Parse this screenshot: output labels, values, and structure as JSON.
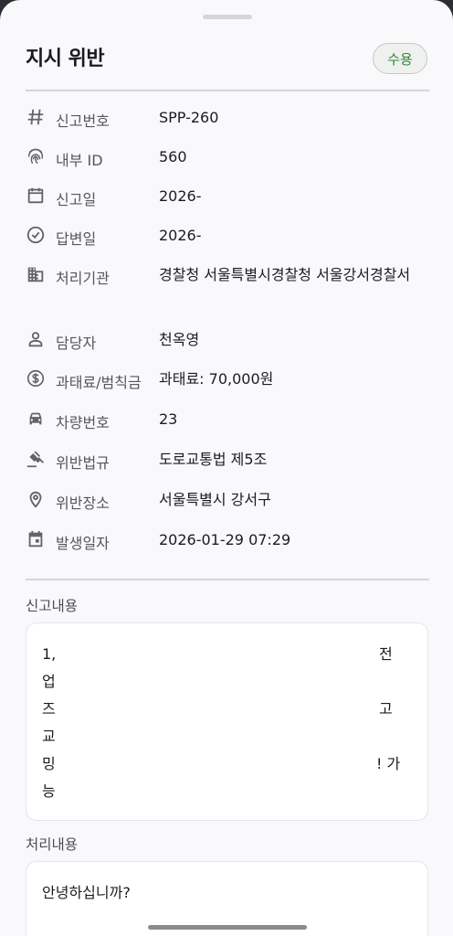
{
  "header": {
    "title": "지시 위반",
    "status": "수용"
  },
  "details": [
    {
      "icon": "hash-icon",
      "label": "신고번호",
      "value": "SPP-260"
    },
    {
      "icon": "fingerprint-icon",
      "label": "내부 ID",
      "value": "560"
    },
    {
      "icon": "calendar-icon",
      "label": "신고일",
      "value": "2026-"
    },
    {
      "icon": "check-circle-icon",
      "label": "답변일",
      "value": "2026-"
    },
    {
      "icon": "building-icon",
      "label": "처리기관",
      "value": "경찰청 서울특별시경찰청 서울강서경찰서"
    },
    {
      "icon": "person-icon",
      "label": "담당자",
      "value": "천옥영"
    },
    {
      "icon": "dollar-circle-icon",
      "label": "과태료/범칙금",
      "value": "과태료: 70,000원"
    },
    {
      "icon": "car-icon",
      "label": "차량번호",
      "value": "23"
    },
    {
      "icon": "gavel-icon",
      "label": "위반법규",
      "value": "도로교통법 제5조"
    },
    {
      "icon": "location-pin-icon",
      "label": "위반장소",
      "value": "서울특별시 강서구"
    },
    {
      "icon": "event-calendar-icon",
      "label": "발생일자",
      "value": "2026-01-29  07:29"
    }
  ],
  "report": {
    "title": "신고내용",
    "lines": [
      "1,",
      "업",
      "즈",
      "교",
      "밍",
      "능"
    ],
    "right_fragments": [
      "전",
      "고",
      "! 가"
    ]
  },
  "response": {
    "title": "처리내용",
    "text": "안녕하십니까?"
  }
}
